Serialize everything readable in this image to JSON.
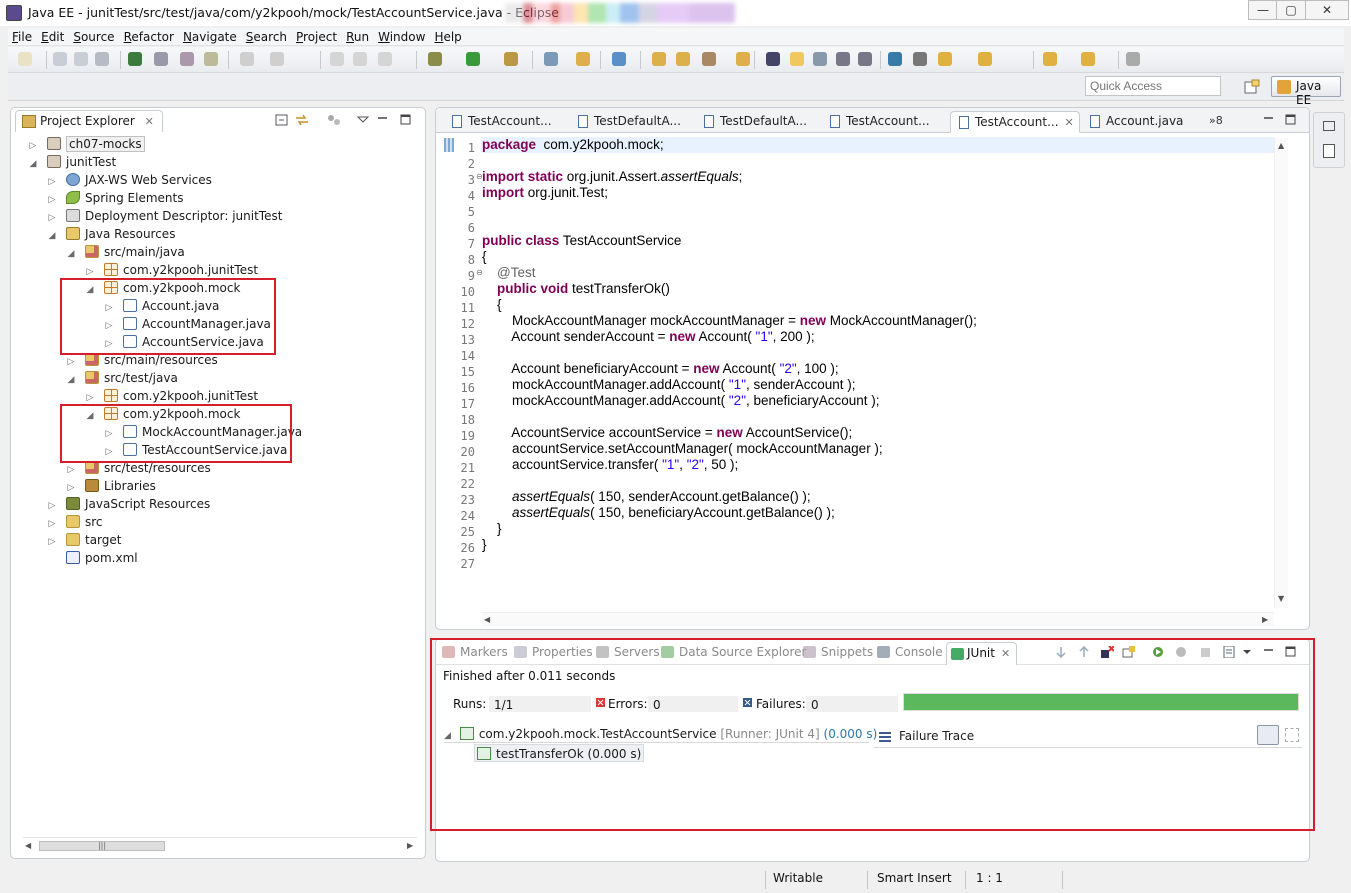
{
  "window": {
    "title": "Java EE - junitTest/src/test/java/com/y2kpooh/mock/TestAccountService.java - Eclipse",
    "minimize_glyph": "—",
    "maximize_glyph": "▢",
    "close_glyph": "✕"
  },
  "menu": [
    "File",
    "Edit",
    "Source",
    "Refactor",
    "Navigate",
    "Search",
    "Project",
    "Run",
    "Window",
    "Help"
  ],
  "quick_access": {
    "placeholder": "Quick Access"
  },
  "perspective": {
    "label": "Java EE"
  },
  "project_explorer": {
    "tab_label": "Project Explorer",
    "tree": [
      {
        "label": "ch07-mocks",
        "depth": 0,
        "twisty": "▷",
        "icon": "project-icon"
      },
      {
        "label": "junitTest",
        "depth": 0,
        "twisty": "◢",
        "icon": "project-icon"
      },
      {
        "label": "JAX-WS Web Services",
        "depth": 1,
        "twisty": "▷",
        "icon": "web-services-icon"
      },
      {
        "label": "Spring Elements",
        "depth": 1,
        "twisty": "▷",
        "icon": "spring-icon"
      },
      {
        "label": "Deployment Descriptor: junitTest",
        "depth": 1,
        "twisty": "▷",
        "icon": "deployment-descriptor-icon"
      },
      {
        "label": "Java Resources",
        "depth": 1,
        "twisty": "◢",
        "icon": "java-resources-icon"
      },
      {
        "label": "src/main/java",
        "depth": 2,
        "twisty": "◢",
        "icon": "source-folder-icon"
      },
      {
        "label": "com.y2kpooh.junitTest",
        "depth": 3,
        "twisty": "▷",
        "icon": "package-icon"
      },
      {
        "label": "com.y2kpooh.mock",
        "depth": 3,
        "twisty": "◢",
        "icon": "package-icon"
      },
      {
        "label": "Account.java",
        "depth": 4,
        "twisty": "▷",
        "icon": "java-file-icon"
      },
      {
        "label": "AccountManager.java",
        "depth": 4,
        "twisty": "▷",
        "icon": "java-file-icon"
      },
      {
        "label": "AccountService.java",
        "depth": 4,
        "twisty": "▷",
        "icon": "java-file-icon"
      },
      {
        "label": "src/main/resources",
        "depth": 2,
        "twisty": "▷",
        "icon": "source-folder-icon"
      },
      {
        "label": "src/test/java",
        "depth": 2,
        "twisty": "◢",
        "icon": "source-folder-icon"
      },
      {
        "label": "com.y2kpooh.junitTest",
        "depth": 3,
        "twisty": "▷",
        "icon": "package-icon"
      },
      {
        "label": "com.y2kpooh.mock",
        "depth": 3,
        "twisty": "◢",
        "icon": "package-icon"
      },
      {
        "label": "MockAccountManager.java",
        "depth": 4,
        "twisty": "▷",
        "icon": "java-file-icon"
      },
      {
        "label": "TestAccountService.java",
        "depth": 4,
        "twisty": "▷",
        "icon": "java-file-icon"
      },
      {
        "label": "src/test/resources",
        "depth": 2,
        "twisty": "▷",
        "icon": "source-folder-icon"
      },
      {
        "label": "Libraries",
        "depth": 2,
        "twisty": "▷",
        "icon": "libraries-icon"
      },
      {
        "label": "JavaScript Resources",
        "depth": 1,
        "twisty": "▷",
        "icon": "javascript-resources-icon"
      },
      {
        "label": "src",
        "depth": 1,
        "twisty": "▷",
        "icon": "folder-icon"
      },
      {
        "label": "target",
        "depth": 1,
        "twisty": "▷",
        "icon": "folder-icon"
      },
      {
        "label": "pom.xml",
        "depth": 1,
        "twisty": "",
        "icon": "maven-pom-icon"
      }
    ]
  },
  "editor": {
    "tabs": [
      "TestAccount...",
      "TestDefaultA...",
      "TestDefaultA...",
      "TestAccount...",
      "TestAccount...",
      "Account.java"
    ],
    "active_tab": 4,
    "overflow_label": "»8",
    "lines": [
      [
        [
          "kw",
          "package"
        ],
        [
          "",
          "  com.y2kpooh.mock;"
        ]
      ],
      [],
      [
        [
          "kw",
          "import"
        ],
        [
          "",
          " "
        ],
        [
          "kw",
          "static"
        ],
        [
          "",
          " org.junit.Assert."
        ],
        [
          "it",
          "assertEquals"
        ],
        [
          "",
          ";"
        ]
      ],
      [
        [
          "kw",
          "import"
        ],
        [
          "",
          " org.junit.Test;"
        ]
      ],
      [],
      [],
      [
        [
          "kw",
          "public"
        ],
        [
          "",
          " "
        ],
        [
          "kw",
          "class"
        ],
        [
          "",
          " TestAccountService"
        ]
      ],
      [
        [
          "",
          "{"
        ]
      ],
      [
        [
          "ann",
          "    @Test"
        ]
      ],
      [
        [
          "",
          "    "
        ],
        [
          "kw",
          "public"
        ],
        [
          "",
          " "
        ],
        [
          "kw",
          "void"
        ],
        [
          "",
          " testTransferOk()"
        ]
      ],
      [
        [
          "",
          "    {"
        ]
      ],
      [
        [
          "",
          "        MockAccountManager mockAccountManager = "
        ],
        [
          "kw",
          "new"
        ],
        [
          "",
          " MockAccountManager();"
        ]
      ],
      [
        [
          "",
          "        Account senderAccount = "
        ],
        [
          "kw",
          "new"
        ],
        [
          "",
          " Account( "
        ],
        [
          "str",
          "\"1\""
        ],
        [
          "",
          ", 200 );"
        ]
      ],
      [],
      [
        [
          "",
          "        Account beneficiaryAccount = "
        ],
        [
          "kw",
          "new"
        ],
        [
          "",
          " Account( "
        ],
        [
          "str",
          "\"2\""
        ],
        [
          "",
          ", 100 );"
        ]
      ],
      [
        [
          "",
          "        mockAccountManager.addAccount( "
        ],
        [
          "str",
          "\"1\""
        ],
        [
          "",
          ", senderAccount );"
        ]
      ],
      [
        [
          "",
          "        mockAccountManager.addAccount( "
        ],
        [
          "str",
          "\"2\""
        ],
        [
          "",
          ", beneficiaryAccount );"
        ]
      ],
      [],
      [
        [
          "",
          "        AccountService accountService = "
        ],
        [
          "kw",
          "new"
        ],
        [
          "",
          " AccountService();"
        ]
      ],
      [
        [
          "",
          "        accountService.setAccountManager( mockAccountManager );"
        ]
      ],
      [
        [
          "",
          "        accountService.transfer( "
        ],
        [
          "str",
          "\"1\""
        ],
        [
          "",
          ", "
        ],
        [
          "str",
          "\"2\""
        ],
        [
          "",
          ", 50 );"
        ]
      ],
      [],
      [
        [
          "",
          "        "
        ],
        [
          "it",
          "assertEquals"
        ],
        [
          "",
          "( 150, senderAccount.getBalance() );"
        ]
      ],
      [
        [
          "",
          "        "
        ],
        [
          "it",
          "assertEquals"
        ],
        [
          "",
          "( 150, beneficiaryAccount.getBalance() );"
        ]
      ],
      [
        [
          "",
          "    }"
        ]
      ],
      [
        [
          "",
          "}"
        ]
      ],
      []
    ]
  },
  "bottom_panel": {
    "tabs": [
      {
        "label": "Markers",
        "icon": "markers-icon"
      },
      {
        "label": "Properties",
        "icon": "properties-icon"
      },
      {
        "label": "Servers",
        "icon": "servers-icon"
      },
      {
        "label": "Data Source Explorer",
        "icon": "data-source-icon"
      },
      {
        "label": "Snippets",
        "icon": "snippets-icon"
      },
      {
        "label": "Console",
        "icon": "console-icon"
      },
      {
        "label": "JUnit",
        "icon": "junit-icon"
      }
    ],
    "junit": {
      "status": "Finished after 0.011 seconds",
      "runs_label": "Runs:",
      "runs_value": "1/1",
      "errors_label": "Errors:",
      "errors_value": "0",
      "failures_label": "Failures:",
      "failures_value": "0",
      "progress_fraction": 1.0,
      "progress_color": "#5cb85c",
      "suite_name": "com.y2kpooh.mock.TestAccountService",
      "suite_runner": "[Runner: JUnit 4]",
      "suite_time": "(0.000 s)",
      "test_label": "testTransferOk (0.000 s)",
      "failure_trace_label": "Failure Trace"
    }
  },
  "status_bar": {
    "writable": "Writable",
    "insert_mode": "Smart Insert",
    "position": "1 : 1"
  },
  "colors": {
    "highlight_box": "#d41f2a",
    "keyword": "#7f0055",
    "string": "#2a00ff"
  }
}
